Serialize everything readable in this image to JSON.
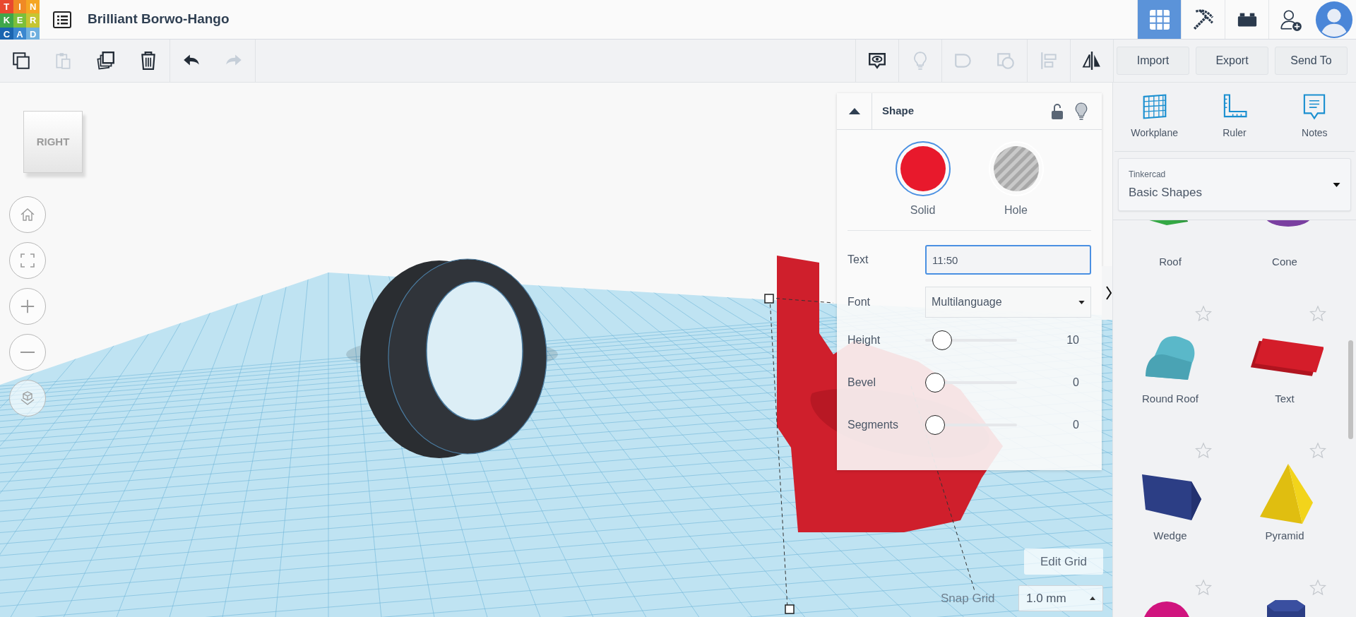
{
  "header": {
    "logo_letters": [
      "T",
      "I",
      "N",
      "K",
      "E",
      "R",
      "C",
      "A",
      "D"
    ],
    "title": "Brilliant Borwo-Hango",
    "view_modes": [
      {
        "kind": "grid",
        "selected": true
      },
      {
        "kind": "pickaxe",
        "selected": false
      },
      {
        "kind": "bricks",
        "selected": false
      }
    ]
  },
  "toolbar": {
    "tools": [
      {
        "kind": "copy",
        "disabled": false
      },
      {
        "kind": "paste",
        "disabled": true
      },
      {
        "kind": "duplicate",
        "disabled": false
      },
      {
        "kind": "delete",
        "disabled": false
      },
      {
        "kind": "undo",
        "disabled": false
      },
      {
        "kind": "redo",
        "disabled": true
      }
    ],
    "right_tools": [
      {
        "kind": "notes",
        "disabled": false
      },
      {
        "kind": "bulb",
        "disabled": true
      },
      {
        "kind": "group",
        "disabled": true
      },
      {
        "kind": "ungroup",
        "disabled": true
      },
      {
        "kind": "align",
        "disabled": true
      },
      {
        "kind": "mirror",
        "disabled": false
      }
    ],
    "buttons": [
      "Import",
      "Export",
      "Send To"
    ]
  },
  "view_cube": {
    "label": "RIGHT"
  },
  "shape_panel": {
    "title": "Shape",
    "types": [
      {
        "kind": "solid",
        "label": "Solid",
        "selected": true
      },
      {
        "kind": "hole",
        "label": "Hole",
        "selected": false
      }
    ],
    "text": {
      "label": "Text",
      "value": "11:50"
    },
    "font": {
      "label": "Font",
      "value": "Multilanguage"
    },
    "sliders": [
      {
        "label": "Height",
        "level": 0.1,
        "reading": "10"
      },
      {
        "label": "Bevel",
        "level": 0,
        "reading": "0"
      },
      {
        "label": "Segments",
        "level": 0,
        "reading": "0"
      }
    ]
  },
  "grid_controls": {
    "edit_button": "Edit Grid",
    "snap_label": "Snap Grid",
    "snap_value": "1.0 mm"
  },
  "sidebar": {
    "tools": [
      {
        "kind": "workplane",
        "label": "Workplane"
      },
      {
        "kind": "ruler",
        "label": "Ruler"
      },
      {
        "kind": "notes",
        "label": "Notes"
      }
    ],
    "library": {
      "provider": "Tinkercad",
      "value": "Basic Shapes"
    },
    "shapes": [
      {
        "kind": "roof",
        "label": "Roof"
      },
      {
        "kind": "cone",
        "label": "Cone"
      },
      {
        "kind": "round_roof",
        "label": "Round Roof"
      },
      {
        "kind": "text",
        "label": "Text"
      },
      {
        "kind": "wedge",
        "label": "Wedge"
      },
      {
        "kind": "pyramid",
        "label": "Pyramid"
      },
      {
        "kind": "sphere"
      },
      {
        "kind": "prism"
      }
    ]
  }
}
